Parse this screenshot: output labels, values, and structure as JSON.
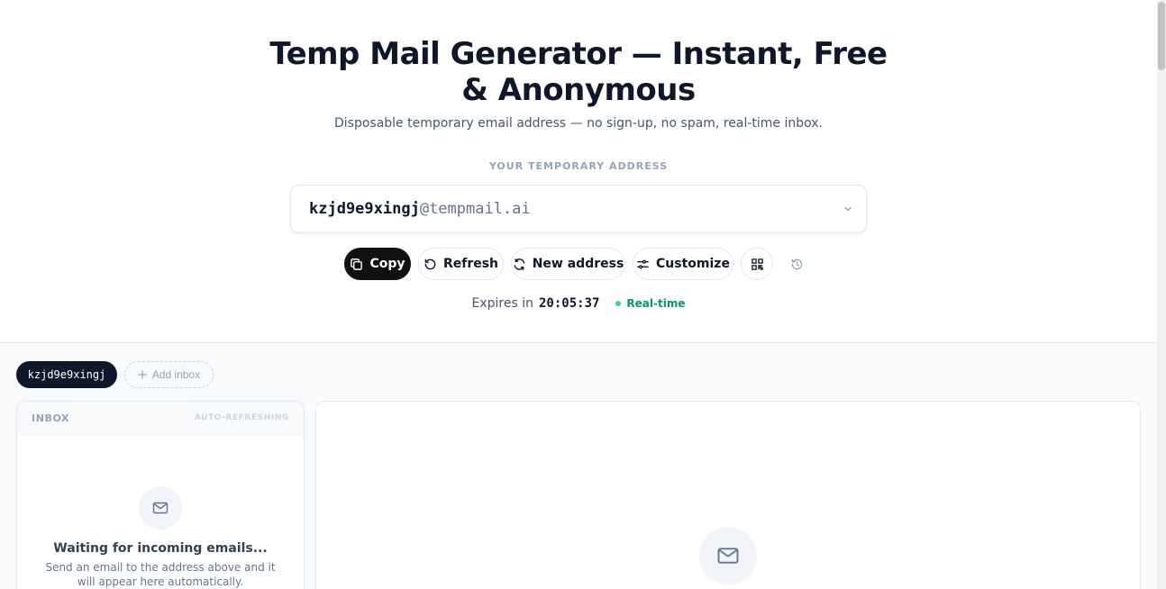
{
  "header": {
    "title": "Temp Mail Generator — Instant, Free & Anonymous",
    "subtitle": "Disposable temporary email address — no sign-up, no spam, real-time inbox.",
    "address_label": "YOUR TEMPORARY ADDRESS"
  },
  "address": {
    "user": "kzjd9e9xingj",
    "domain": "@tempmail.ai"
  },
  "actions": {
    "copy": "Copy",
    "refresh": "Refresh",
    "new_address": "New address",
    "customize": "Customize"
  },
  "status": {
    "expires_prefix": "Expires in",
    "timer": "20:05:37",
    "realtime": "Real-time",
    "realtime_color": "#059669"
  },
  "inbox_tabs": {
    "active": "kzjd9e9xingj",
    "add": "Add inbox"
  },
  "inbox": {
    "title": "INBOX",
    "auto": "AUTO-REFRESHING",
    "waiting": "Waiting for incoming emails...",
    "waiting_sub": "Send an email to the address above and it will appear here automatically."
  },
  "icons": [
    "copy-icon",
    "refresh-icon",
    "new-address-icon",
    "customize-icon",
    "qr-code-icon",
    "history-icon",
    "chevron-down-icon",
    "plus-icon",
    "mail-icon"
  ],
  "colors": {
    "primary": "#111111",
    "text": "#0f172a",
    "muted": "#94a3b8"
  }
}
